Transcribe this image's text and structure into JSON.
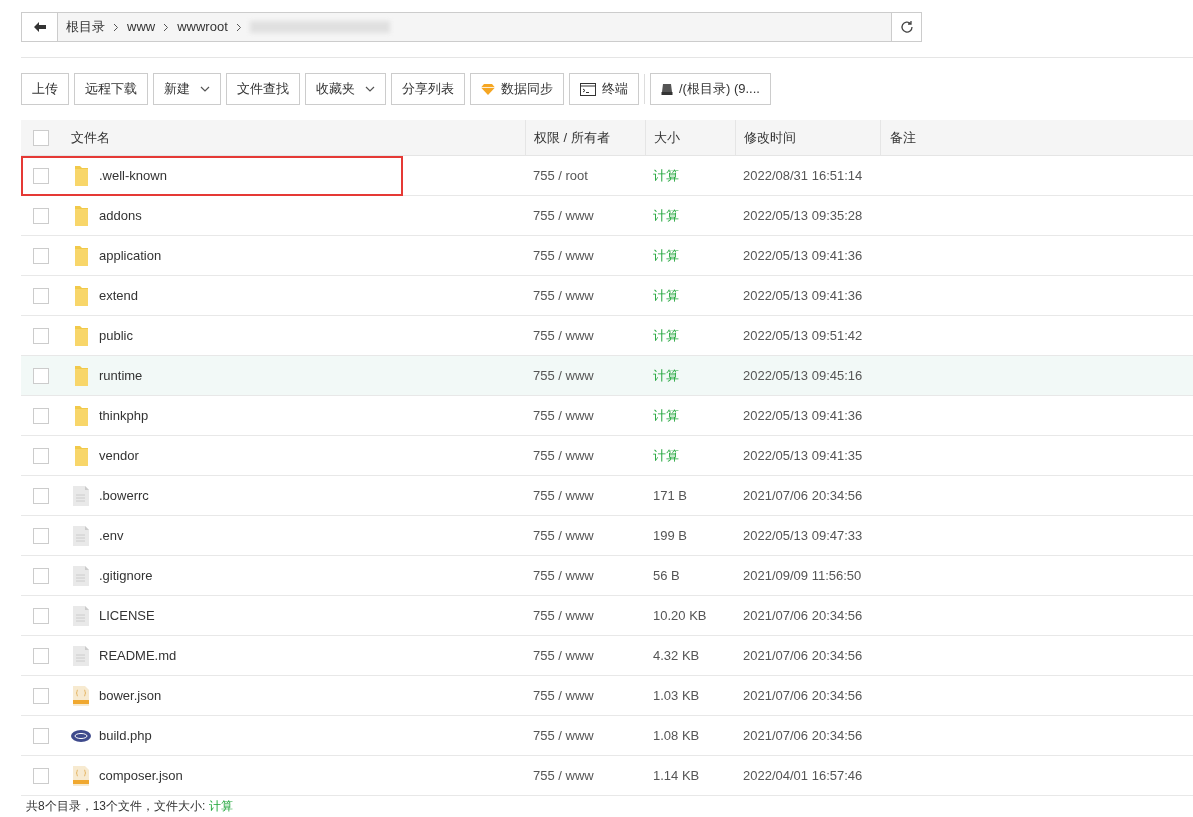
{
  "breadcrumb": {
    "items": [
      "根目录",
      "www",
      "wwwroot"
    ],
    "hidden_tail": true
  },
  "toolbar": [
    {
      "label": "上传",
      "kind": "plain"
    },
    {
      "label": "远程下载",
      "kind": "plain"
    },
    {
      "label": "新建",
      "kind": "dropdown"
    },
    {
      "label": "文件查找",
      "kind": "plain"
    },
    {
      "label": "收藏夹",
      "kind": "dropdown"
    },
    {
      "label": "分享列表",
      "kind": "plain"
    },
    {
      "label": "数据同步",
      "kind": "sync"
    },
    {
      "label": "终端",
      "kind": "terminal"
    },
    {
      "label": "/(根目录) (9....",
      "kind": "disk"
    }
  ],
  "table": {
    "select_all_checked": false,
    "columns": [
      "文件名",
      "权限 / 所有者",
      "大小",
      "修改时间",
      "备注"
    ],
    "rows": [
      {
        "name": ".well-known",
        "kind": "folder",
        "perm": "755 / root",
        "size": "计算",
        "time": "2022/08/31 16:51:14",
        "checked": false,
        "hovered": false,
        "outlined": true
      },
      {
        "name": "addons",
        "kind": "folder",
        "perm": "755 / www",
        "size": "计算",
        "time": "2022/05/13 09:35:28",
        "checked": false,
        "hovered": false,
        "outlined": false
      },
      {
        "name": "application",
        "kind": "folder",
        "perm": "755 / www",
        "size": "计算",
        "time": "2022/05/13 09:41:36",
        "checked": false,
        "hovered": false,
        "outlined": false
      },
      {
        "name": "extend",
        "kind": "folder",
        "perm": "755 / www",
        "size": "计算",
        "time": "2022/05/13 09:41:36",
        "checked": false,
        "hovered": false,
        "outlined": false
      },
      {
        "name": "public",
        "kind": "folder",
        "perm": "755 / www",
        "size": "计算",
        "time": "2022/05/13 09:51:42",
        "checked": false,
        "hovered": false,
        "outlined": false
      },
      {
        "name": "runtime",
        "kind": "folder",
        "perm": "755 / www",
        "size": "计算",
        "time": "2022/05/13 09:45:16",
        "checked": false,
        "hovered": true,
        "outlined": false
      },
      {
        "name": "thinkphp",
        "kind": "folder",
        "perm": "755 / www",
        "size": "计算",
        "time": "2022/05/13 09:41:36",
        "checked": false,
        "hovered": false,
        "outlined": false
      },
      {
        "name": "vendor",
        "kind": "folder",
        "perm": "755 / www",
        "size": "计算",
        "time": "2022/05/13 09:41:35",
        "checked": false,
        "hovered": false,
        "outlined": false
      },
      {
        "name": ".bowerrc",
        "kind": "file",
        "perm": "755 / www",
        "size": "171 B",
        "time": "2021/07/06 20:34:56",
        "checked": false,
        "hovered": false,
        "outlined": false
      },
      {
        "name": ".env",
        "kind": "file",
        "perm": "755 / www",
        "size": "199 B",
        "time": "2022/05/13 09:47:33",
        "checked": false,
        "hovered": false,
        "outlined": false
      },
      {
        "name": ".gitignore",
        "kind": "file",
        "perm": "755 / www",
        "size": "56 B",
        "time": "2021/09/09 11:56:50",
        "checked": false,
        "hovered": false,
        "outlined": false
      },
      {
        "name": "LICENSE",
        "kind": "file",
        "perm": "755 / www",
        "size": "10.20 KB",
        "time": "2021/07/06 20:34:56",
        "checked": false,
        "hovered": false,
        "outlined": false
      },
      {
        "name": "README.md",
        "kind": "file",
        "perm": "755 / www",
        "size": "4.32 KB",
        "time": "2021/07/06 20:34:56",
        "checked": false,
        "hovered": false,
        "outlined": false
      },
      {
        "name": "bower.json",
        "kind": "json",
        "perm": "755 / www",
        "size": "1.03 KB",
        "time": "2021/07/06 20:34:56",
        "checked": false,
        "hovered": false,
        "outlined": false
      },
      {
        "name": "build.php",
        "kind": "php",
        "perm": "755 / www",
        "size": "1.08 KB",
        "time": "2021/07/06 20:34:56",
        "checked": false,
        "hovered": false,
        "outlined": false
      },
      {
        "name": "composer.json",
        "kind": "json",
        "perm": "755 / www",
        "size": "1.14 KB",
        "time": "2022/04/01 16:57:46",
        "checked": false,
        "hovered": false,
        "outlined": false
      }
    ]
  },
  "footer": {
    "summary": "共8个目录，13个文件，文件大小:",
    "action": "计算"
  }
}
